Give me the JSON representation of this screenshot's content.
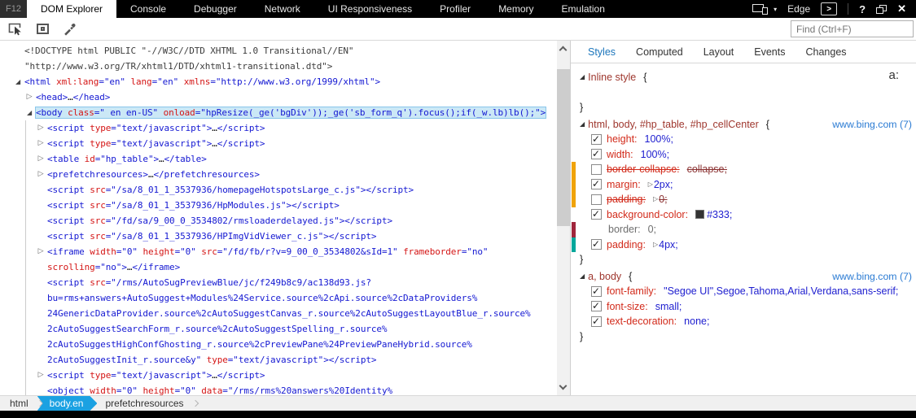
{
  "window": {
    "f12": "F12",
    "tabs": [
      {
        "label": "DOM Explorer",
        "active": true
      },
      {
        "label": "Console",
        "active": false
      },
      {
        "label": "Debugger",
        "active": false
      },
      {
        "label": "Network",
        "active": false
      },
      {
        "label": "UI Responsiveness",
        "active": false
      },
      {
        "label": "Profiler",
        "active": false
      },
      {
        "label": "Memory",
        "active": false
      },
      {
        "label": "Emulation",
        "active": false
      }
    ],
    "target_label": "Edge",
    "device_caret": "▾",
    "controls": {
      "console": ">",
      "help": "?",
      "close": "✕"
    }
  },
  "toolbar": {
    "icons": [
      "select-element-icon",
      "element-highlight-icon",
      "color-picker-icon"
    ],
    "find_placeholder": "Find (Ctrl+F)"
  },
  "dom_tree": {
    "lines": [
      {
        "i": 0,
        "s": [
          {
            "c": "d",
            "x": "<!DOCTYPE html PUBLIC \"-//W3C//DTD XHTML 1.0 Transitional//EN\""
          }
        ]
      },
      {
        "i": 0,
        "s": [
          {
            "c": "d",
            "x": "\"http://www.w3.org/TR/xhtml1/DTD/xhtml1-transitional.dtd\">"
          }
        ]
      },
      {
        "i": 0,
        "arrow": "open",
        "s": [
          {
            "c": "t",
            "x": "<html "
          },
          {
            "c": "a",
            "x": "xml:lang"
          },
          {
            "c": "v",
            "x": "=\"en\" "
          },
          {
            "c": "a",
            "x": "lang"
          },
          {
            "c": "v",
            "x": "=\"en\" "
          },
          {
            "c": "a",
            "x": "xmlns"
          },
          {
            "c": "v",
            "x": "=\"http://www.w3.org/1999/xhtml\""
          },
          {
            "c": "t",
            "x": ">"
          }
        ]
      },
      {
        "i": 1,
        "arrow": "closed",
        "s": [
          {
            "c": "t",
            "x": "<head>"
          },
          {
            "c": "p",
            "x": "…"
          },
          {
            "c": "t",
            "x": "</head>"
          }
        ]
      },
      {
        "i": 1,
        "arrow": "open",
        "sel": true,
        "s": [
          {
            "c": "t",
            "x": "<body "
          },
          {
            "c": "a",
            "x": "class"
          },
          {
            "c": "v",
            "x": "=\" en en-US\" "
          },
          {
            "c": "a",
            "x": "onload"
          },
          {
            "c": "v",
            "x": "=\"hpResize(_ge('bgDiv'));_ge('sb_form_q').focus();if(_w.lb)lb();\""
          },
          {
            "c": "t",
            "x": ">"
          }
        ]
      },
      {
        "i": 2,
        "arrow": "closed",
        "s": [
          {
            "c": "t",
            "x": "<script "
          },
          {
            "c": "a",
            "x": "type"
          },
          {
            "c": "v",
            "x": "=\"text/javascript\""
          },
          {
            "c": "t",
            "x": ">"
          },
          {
            "c": "p",
            "x": "…"
          },
          {
            "c": "t",
            "x": "</script>"
          }
        ]
      },
      {
        "i": 2,
        "arrow": "closed",
        "s": [
          {
            "c": "t",
            "x": "<script "
          },
          {
            "c": "a",
            "x": "type"
          },
          {
            "c": "v",
            "x": "=\"text/javascript\""
          },
          {
            "c": "t",
            "x": ">"
          },
          {
            "c": "p",
            "x": "…"
          },
          {
            "c": "t",
            "x": "</script>"
          }
        ]
      },
      {
        "i": 2,
        "arrow": "closed",
        "s": [
          {
            "c": "t",
            "x": "<table "
          },
          {
            "c": "a",
            "x": "id"
          },
          {
            "c": "v",
            "x": "=\"hp_table\""
          },
          {
            "c": "t",
            "x": ">"
          },
          {
            "c": "p",
            "x": "…"
          },
          {
            "c": "t",
            "x": "</table>"
          }
        ]
      },
      {
        "i": 2,
        "arrow": "closed",
        "s": [
          {
            "c": "t",
            "x": "<prefetchresources>"
          },
          {
            "c": "p",
            "x": "…"
          },
          {
            "c": "t",
            "x": "</prefetchresources>"
          }
        ]
      },
      {
        "i": 2,
        "s": [
          {
            "c": "t",
            "x": "<script "
          },
          {
            "c": "a",
            "x": "src"
          },
          {
            "c": "v",
            "x": "=\"/sa/8_01_1_3537936/homepageHotspotsLarge_c.js\""
          },
          {
            "c": "t",
            "x": "></script>"
          }
        ]
      },
      {
        "i": 2,
        "s": [
          {
            "c": "t",
            "x": "<script "
          },
          {
            "c": "a",
            "x": "src"
          },
          {
            "c": "v",
            "x": "=\"/sa/8_01_1_3537936/HpModules.js\""
          },
          {
            "c": "t",
            "x": "></script>"
          }
        ]
      },
      {
        "i": 2,
        "s": [
          {
            "c": "t",
            "x": "<script "
          },
          {
            "c": "a",
            "x": "src"
          },
          {
            "c": "v",
            "x": "=\"/fd/sa/9_00_0_3534802/rmsloaderdelayed.js\""
          },
          {
            "c": "t",
            "x": "></script>"
          }
        ]
      },
      {
        "i": 2,
        "s": [
          {
            "c": "t",
            "x": "<script "
          },
          {
            "c": "a",
            "x": "src"
          },
          {
            "c": "v",
            "x": "=\"/sa/8_01_1_3537936/HPImgVidViewer_c.js\""
          },
          {
            "c": "t",
            "x": "></script>"
          }
        ]
      },
      {
        "i": 2,
        "arrow": "closed",
        "s": [
          {
            "c": "t",
            "x": "<iframe "
          },
          {
            "c": "a",
            "x": "width"
          },
          {
            "c": "v",
            "x": "=\"0\" "
          },
          {
            "c": "a",
            "x": "height"
          },
          {
            "c": "v",
            "x": "=\"0\" "
          },
          {
            "c": "a",
            "x": "src"
          },
          {
            "c": "v",
            "x": "=\"/fd/fb/r?v=9_00_0_3534802&sId=1\" "
          },
          {
            "c": "a",
            "x": "frameborder"
          },
          {
            "c": "v",
            "x": "=\"no\""
          }
        ]
      },
      {
        "i": 2,
        "s": [
          {
            "c": "a",
            "x": "scrolling"
          },
          {
            "c": "v",
            "x": "=\"no\""
          },
          {
            "c": "t",
            "x": ">"
          },
          {
            "c": "p",
            "x": "…"
          },
          {
            "c": "t",
            "x": "</iframe>"
          }
        ]
      },
      {
        "i": 2,
        "s": [
          {
            "c": "t",
            "x": "<script "
          },
          {
            "c": "a",
            "x": "src"
          },
          {
            "c": "v",
            "x": "=\"/rms/AutoSugPreviewBlue/jc/f249b8c9/ac138d93.js?"
          }
        ]
      },
      {
        "i": 2,
        "s": [
          {
            "c": "v",
            "x": "bu=rms+answers+AutoSuggest+Modules%24Service.source%2cApi.source%2cDataProviders%"
          }
        ]
      },
      {
        "i": 2,
        "s": [
          {
            "c": "v",
            "x": "24GenericDataProvider.source%2cAutoSuggestCanvas_r.source%2cAutoSuggestLayoutBlue_r.source%"
          }
        ]
      },
      {
        "i": 2,
        "s": [
          {
            "c": "v",
            "x": "2cAutoSuggestSearchForm_r.source%2cAutoSuggestSpelling_r.source%"
          }
        ]
      },
      {
        "i": 2,
        "s": [
          {
            "c": "v",
            "x": "2cAutoSuggestHighConfGhosting_r.source%2cPreviewPane%24PreviewPaneHybrid.source%"
          }
        ]
      },
      {
        "i": 2,
        "s": [
          {
            "c": "v",
            "x": "2cAutoSuggestInit_r.source&y\" "
          },
          {
            "c": "a",
            "x": "type"
          },
          {
            "c": "v",
            "x": "=\"text/javascript\""
          },
          {
            "c": "t",
            "x": "></script>"
          }
        ]
      },
      {
        "i": 2,
        "arrow": "closed",
        "s": [
          {
            "c": "t",
            "x": "<script "
          },
          {
            "c": "a",
            "x": "type"
          },
          {
            "c": "v",
            "x": "=\"text/javascript\""
          },
          {
            "c": "t",
            "x": ">"
          },
          {
            "c": "p",
            "x": "…"
          },
          {
            "c": "t",
            "x": "</script>"
          }
        ]
      },
      {
        "i": 2,
        "s": [
          {
            "c": "t",
            "x": "<object "
          },
          {
            "c": "a",
            "x": "width"
          },
          {
            "c": "v",
            "x": "=\"0\" "
          },
          {
            "c": "a",
            "x": "height"
          },
          {
            "c": "v",
            "x": "=\"0\" "
          },
          {
            "c": "a",
            "x": "data"
          },
          {
            "c": "v",
            "x": "=\"/rms/rms%20answers%20Identity%"
          }
        ]
      }
    ]
  },
  "styles_panel": {
    "tabs": [
      {
        "label": "Styles",
        "active": true
      },
      {
        "label": "Computed",
        "active": false
      },
      {
        "label": "Layout",
        "active": false
      },
      {
        "label": "Events",
        "active": false
      },
      {
        "label": "Changes",
        "active": false
      }
    ],
    "pseudo_button": "a:",
    "rules": [
      {
        "selector": "Inline style",
        "link": null,
        "blank_rows": 1,
        "props": []
      },
      {
        "selector": "html, body, #hp_table, #hp_cellCenter",
        "link": "www.bing.com (7)",
        "blank_rows": 0,
        "props": [
          {
            "checked": true,
            "name": "height",
            "value": "100%"
          },
          {
            "checked": true,
            "name": "width",
            "value": "100%"
          },
          {
            "checked": false,
            "name": "border-collapse",
            "value": "collapse",
            "struck": true,
            "bar": "orange"
          },
          {
            "checked": true,
            "name": "margin",
            "value": "2px",
            "expand": true,
            "bar": "orange"
          },
          {
            "checked": false,
            "name": "padding",
            "value": "0",
            "struck": true,
            "expand": true,
            "bar": "orange"
          },
          {
            "checked": true,
            "name": "background-color",
            "value": "#333",
            "swatch": "#333333"
          },
          {
            "checked": null,
            "name": "border",
            "value": "0",
            "muted": true,
            "bar": "maroon"
          },
          {
            "checked": true,
            "name": "padding",
            "value": "4px",
            "expand": true,
            "bar": "teal"
          }
        ]
      },
      {
        "selector": "a, body",
        "link": "www.bing.com (7)",
        "blank_rows": 0,
        "props": [
          {
            "checked": true,
            "name": "font-family",
            "value": "\"Segoe UI\",Segoe,Tahoma,Arial,Verdana,sans-serif"
          },
          {
            "checked": true,
            "name": "font-size",
            "value": "small"
          },
          {
            "checked": true,
            "name": "text-decoration",
            "value": "none"
          }
        ]
      }
    ]
  },
  "breadcrumb": {
    "items": [
      {
        "label": "html",
        "active": false,
        "chevron_after": true
      },
      {
        "label": "body.en",
        "active": true,
        "chevron_after": false
      },
      {
        "label": "prefetchresources",
        "active": false,
        "chevron_after": true
      }
    ]
  },
  "colors": {
    "selection_blue": "#cbe8f6",
    "breadcrumb_active_blue": "#1ba1e2",
    "change_bar_orange": "#f0a30a",
    "change_bar_maroon": "#a0263c",
    "change_bar_teal": "#00a79b",
    "background_swatch": "#333333",
    "styles_active_tab_blue": "#1b75bb"
  }
}
